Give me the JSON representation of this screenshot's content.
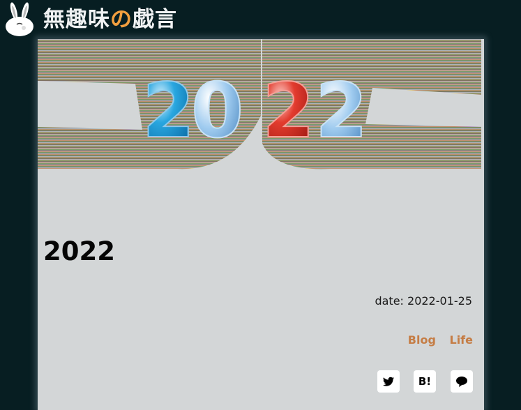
{
  "header": {
    "logo_icon": "rabbit-icon",
    "site_title_before": "無趣味",
    "site_title_accent": "の",
    "site_title_after": "戯言"
  },
  "hero": {
    "year_text": "2022"
  },
  "post": {
    "title": "2022",
    "date_label": "date:",
    "date_value": "2022-01-25",
    "categories": [
      "Blog",
      "Life"
    ]
  },
  "share": {
    "twitter_icon": "twitter-icon",
    "hatena_label": "B!",
    "line_icon": "line-chat-icon"
  },
  "colors": {
    "background": "#071e22",
    "page": "#d3d6d7",
    "accent": "#f29f3f",
    "category": "#c57d45"
  }
}
